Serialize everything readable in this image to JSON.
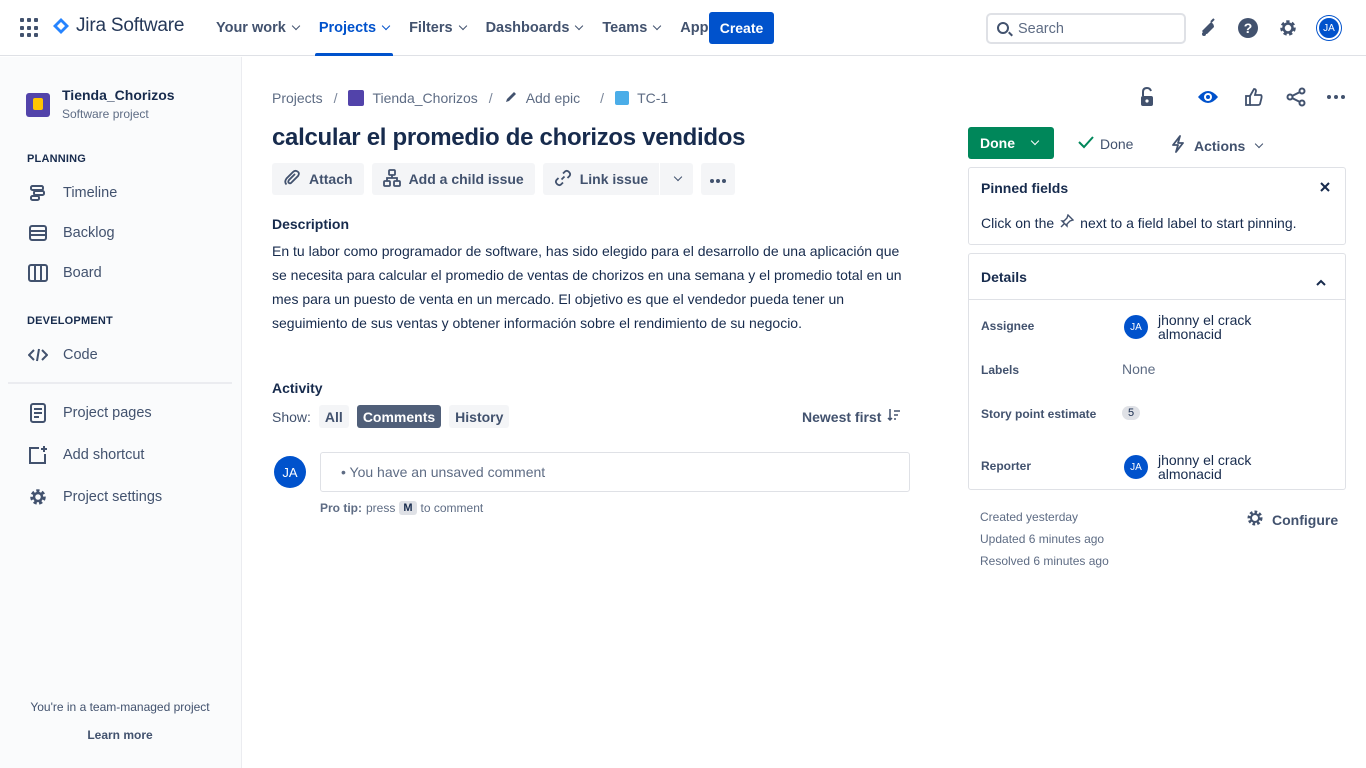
{
  "topnav": {
    "product": "Jira Software",
    "items": [
      {
        "label": "Your work"
      },
      {
        "label": "Projects"
      },
      {
        "label": "Filters"
      },
      {
        "label": "Dashboards"
      },
      {
        "label": "Teams"
      },
      {
        "label": "Apps"
      }
    ],
    "create": "Create",
    "search_placeholder": "Search",
    "user_initials": "JA"
  },
  "sidebar": {
    "project_name": "Tienda_Chorizos",
    "project_type": "Software project",
    "planning_title": "PLANNING",
    "planning_items": [
      {
        "label": "Timeline"
      },
      {
        "label": "Backlog"
      },
      {
        "label": "Board"
      }
    ],
    "development_title": "DEVELOPMENT",
    "development_items": [
      {
        "label": "Code"
      }
    ],
    "other_items": [
      {
        "label": "Project pages"
      },
      {
        "label": "Add shortcut"
      },
      {
        "label": "Project settings"
      }
    ],
    "footer_text": "You're in a team-managed project",
    "learn_more": "Learn more"
  },
  "breadcrumb": {
    "projects": "Projects",
    "project": "Tienda_Chorizos",
    "epic": "Add epic",
    "issue_key": "TC-1"
  },
  "issue": {
    "title": "calcular el promedio de chorizos vendidos",
    "toolbar": {
      "attach": "Attach",
      "child": "Add a child issue",
      "link": "Link issue"
    },
    "description_label": "Description",
    "description": "En tu labor como programador de software, has sido elegido para el desarrollo de una aplicación que se necesita para calcular el promedio de ventas de chorizos en una semana y el promedio total en un mes para un puesto de venta en un mercado. El objetivo es que el vendedor pueda tener un seguimiento de sus ventas y obtener información sobre el rendimiento de su negocio."
  },
  "activity": {
    "title": "Activity",
    "show": "Show:",
    "filters": {
      "all": "All",
      "comments": "Comments",
      "history": "History"
    },
    "sort": "Newest first",
    "comment_avatar": "JA",
    "comment_placeholder": "• You have an unsaved comment",
    "protip_label": "Pro tip:",
    "protip_press": "press",
    "protip_key": "M",
    "protip_suffix": "to comment"
  },
  "status": {
    "button": "Done",
    "resolution": "Done",
    "actions": "Actions",
    "color": "#00875a"
  },
  "pinned": {
    "title": "Pinned fields",
    "text_before": "Click on the",
    "text_after": "next to a field label to start pinning."
  },
  "details": {
    "title": "Details",
    "assignee_label": "Assignee",
    "assignee_initials": "JA",
    "assignee_name": "jhonny el crack almonacid",
    "labels_label": "Labels",
    "labels_value": "None",
    "sp_label": "Story point estimate",
    "sp_value": "5",
    "reporter_label": "Reporter",
    "reporter_initials": "JA",
    "reporter_name": "jhonny el crack almonacid"
  },
  "meta": {
    "created": "Created yesterday",
    "updated": "Updated 6 minutes ago",
    "resolved": "Resolved 6 minutes ago",
    "configure": "Configure"
  },
  "colors": {
    "brand": "#0052cc",
    "text": "#172b4d",
    "subtle": "#42526e"
  }
}
